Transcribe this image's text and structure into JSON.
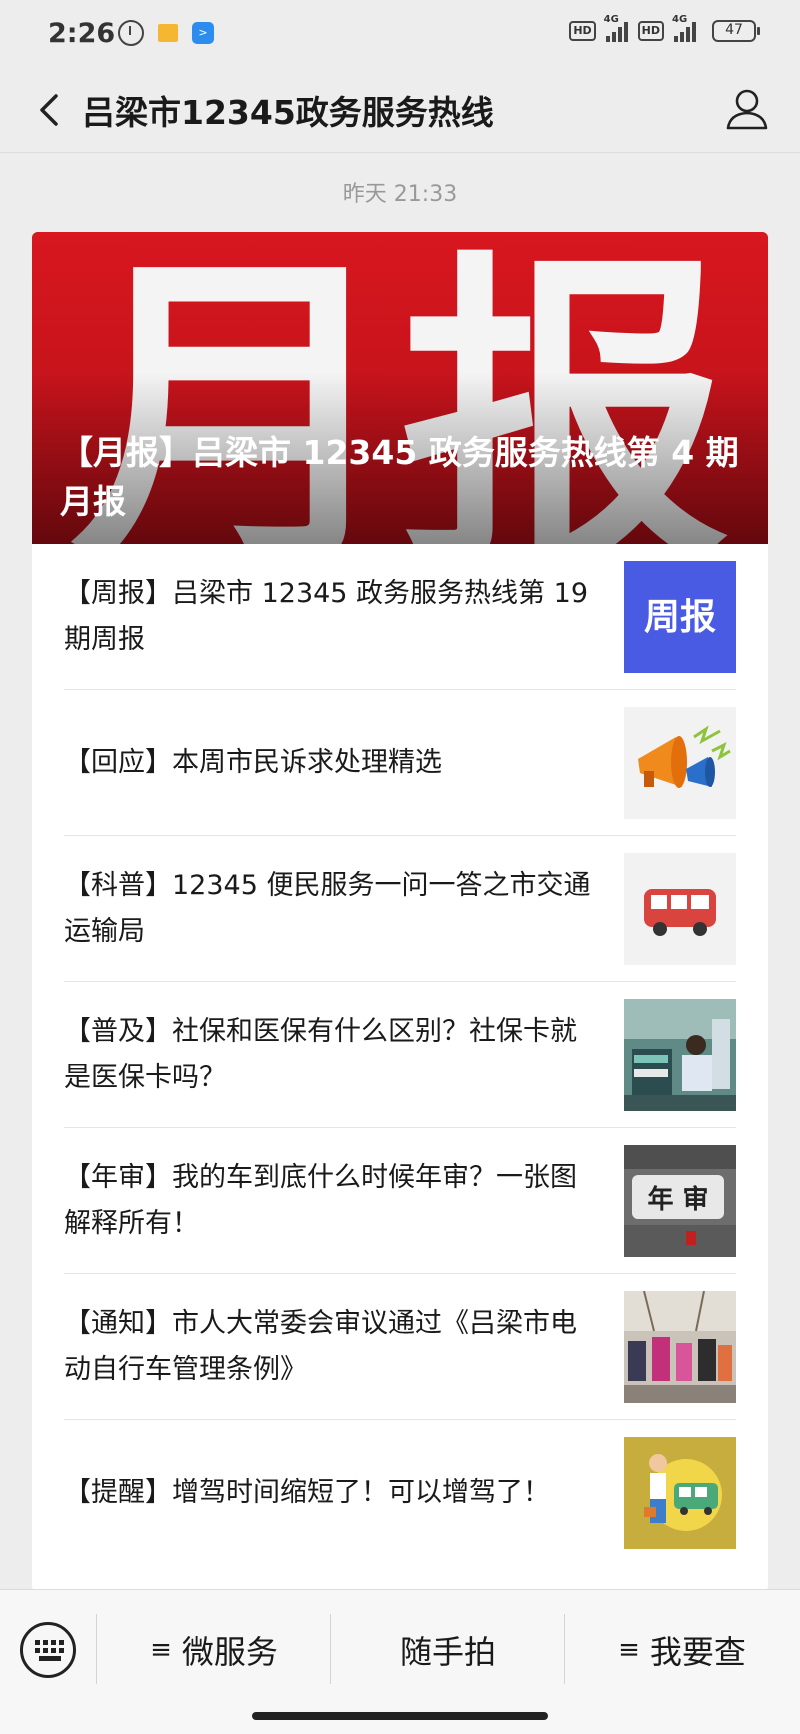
{
  "status": {
    "time": "2:26",
    "battery": "47",
    "net1": "4G",
    "net2": "4G",
    "hd": "HD"
  },
  "header": {
    "title": "吕梁市12345政务服务热线"
  },
  "timestamp": "昨天 21:33",
  "hero": {
    "image_text": "月报",
    "title": "【月报】吕梁市 12345 政务服务热线第 4 期月报"
  },
  "articles": [
    {
      "title": "【周报】吕梁市 12345 政务服务热线第 19 期周报",
      "thumb_text": "周报"
    },
    {
      "title": "【回应】本周市民诉求处理精选"
    },
    {
      "title": "【科普】12345 便民服务一问一答之市交通运输局"
    },
    {
      "title": "【普及】社保和医保有什么区别？社保卡就是医保卡吗？"
    },
    {
      "title": "【年审】我的车到底什么时候年审？一张图解释所有！",
      "thumb_text": "年 审"
    },
    {
      "title": "【通知】市人大常委会审议通过《吕梁市电动自行车管理条例》"
    },
    {
      "title": "【提醒】增驾时间缩短了！可以增驾了！"
    }
  ],
  "menu": {
    "item1": "微服务",
    "item2": "随手拍",
    "item3": "我要查",
    "lines": "≡"
  },
  "colors": {
    "hero_red": "#c8141d",
    "weekly_blue": "#4a5be3",
    "background": "#ededed"
  }
}
